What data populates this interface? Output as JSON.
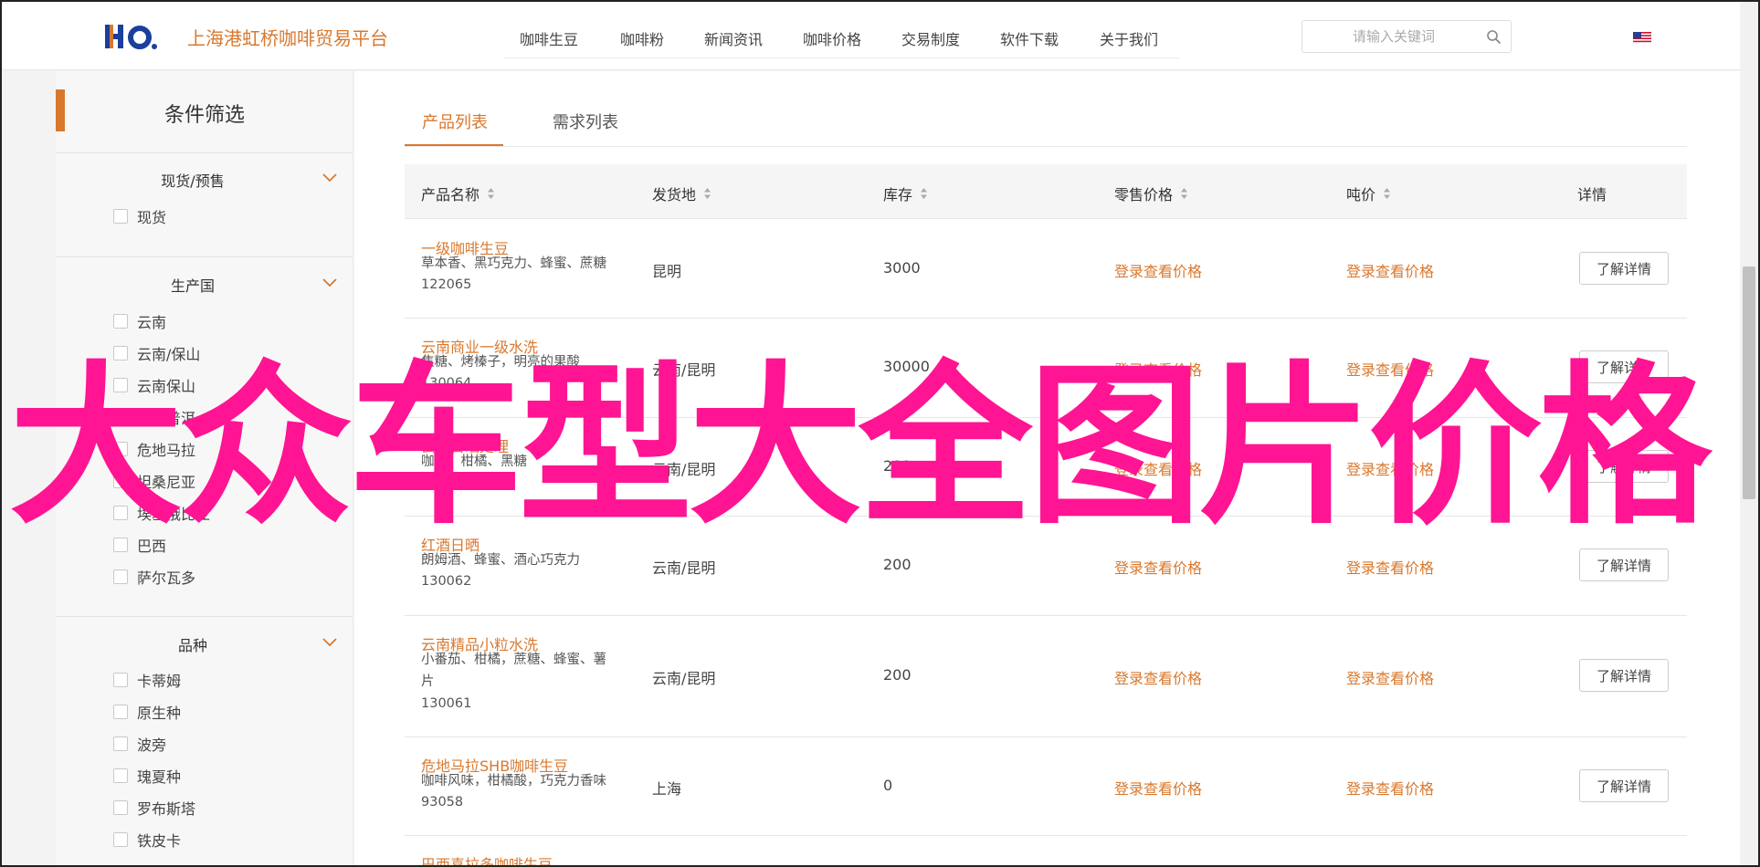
{
  "header": {
    "site_name": "上海港虹桥咖啡贸易平台",
    "nav": [
      "咖啡生豆",
      "咖啡粉",
      "新闻资讯",
      "咖啡价格",
      "交易制度",
      "软件下载",
      "关于我们"
    ],
    "search_placeholder": "请输入关键词",
    "colors": {
      "accent": "#d9782d",
      "logo_blue": "#1a3f9c"
    }
  },
  "sidebar": {
    "title": "条件筛选",
    "groups": [
      {
        "title": "现货/预售",
        "items": [
          "现货"
        ]
      },
      {
        "title": "生产国",
        "items": [
          "云南",
          "云南/保山",
          "云南保山",
          "云南普洱",
          "危地马拉",
          "坦桑尼亚",
          "埃塞俄比亚",
          "巴西",
          "萨尔瓦多"
        ]
      },
      {
        "title": "品种",
        "items": [
          "卡蒂姆",
          "原生种",
          "波旁",
          "瑰夏种",
          "罗布斯塔",
          "铁皮卡"
        ]
      }
    ]
  },
  "main": {
    "tabs": [
      "产品列表",
      "需求列表"
    ],
    "columns": [
      "产品名称",
      "发货地",
      "库存",
      "零售价格",
      "吨价",
      "详情"
    ],
    "price_text": "登录查看价格",
    "detail_label": "了解详情",
    "rows": [
      {
        "name": "一级咖啡生豆",
        "desc": "草本香、黑巧克力、蜂蜜、蔗糖",
        "id": "122065",
        "origin": "昆明",
        "stock": "3000"
      },
      {
        "name": "云南商业一级水洗",
        "desc": "焦糖、烤榛子，明亮的果酸",
        "id": "130064",
        "origin": "云南/昆明",
        "stock": "30000"
      },
      {
        "name": "云南日晒处理",
        "desc": "咖啡、柑橘、黑糖",
        "id": "130063",
        "origin": "云南/昆明",
        "stock": "200"
      },
      {
        "name": "红酒日晒",
        "desc": "朗姆酒、蜂蜜、酒心巧克力",
        "id": "130062",
        "origin": "云南/昆明",
        "stock": "200"
      },
      {
        "name": "云南精品小粒水洗",
        "desc": "小番茄、柑橘，蔗糖、蜂蜜、薯片",
        "id": "130061",
        "origin": "云南/昆明",
        "stock": "200"
      },
      {
        "name": "危地马拉SHB咖啡生豆",
        "desc": "咖啡风味，柑橘酸，巧克力香味",
        "id": "93058",
        "origin": "上海",
        "stock": "0"
      },
      {
        "name": "巴西喜拉多咖啡生豆",
        "desc": "",
        "id": "",
        "origin": "",
        "stock": ""
      }
    ]
  },
  "watermark": "大众车型大全图片价格"
}
